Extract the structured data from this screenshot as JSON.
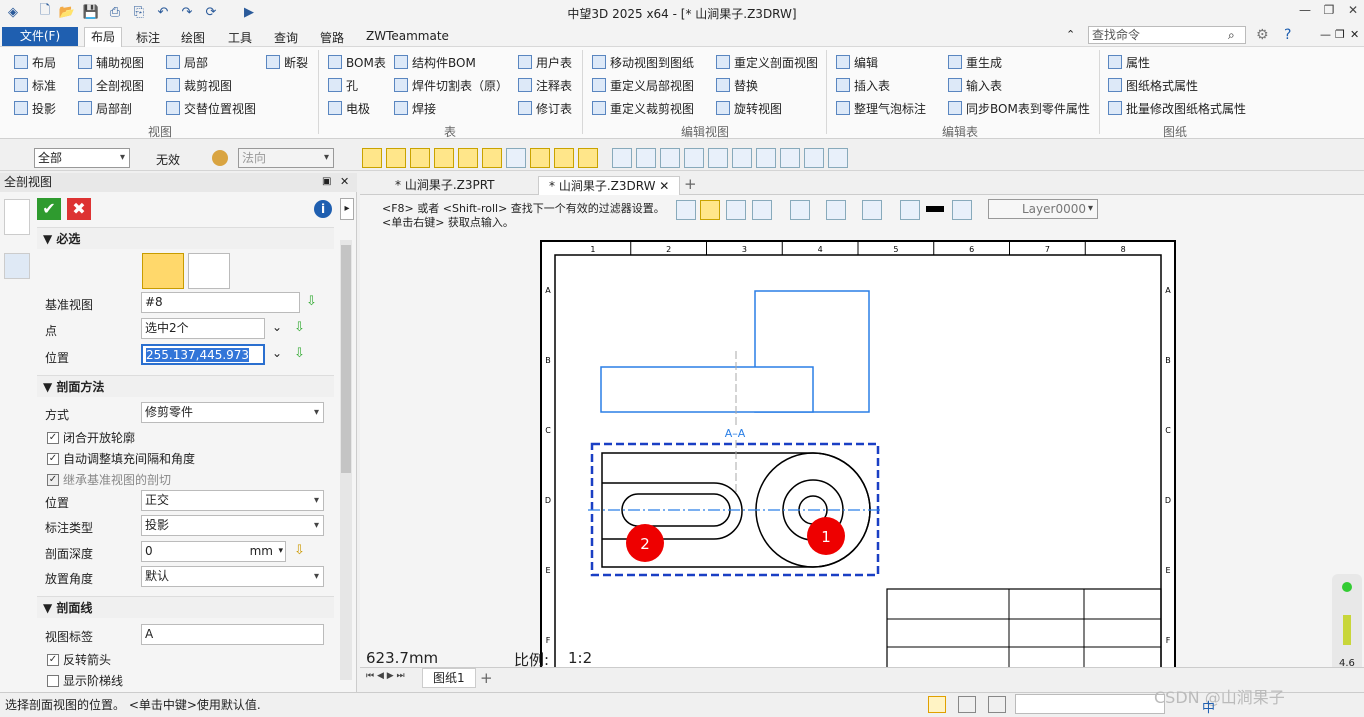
{
  "app": {
    "title": "中望3D 2025 x64 - [* 山涧果子.Z3DRW]"
  },
  "menu": {
    "file": "文件(F)",
    "tabs": [
      "布局",
      "标注",
      "绘图",
      "工具",
      "查询",
      "管路",
      "ZWTeammate"
    ],
    "search_placeholder": "查找命令"
  },
  "ribbon": {
    "view_group": {
      "label": "视图",
      "items": [
        "布局",
        "辅助视图",
        "局部",
        "断裂",
        "标准",
        "全剖视图",
        "裁剪视图",
        "投影",
        "局部剖",
        "交替位置视图"
      ]
    },
    "table_group": {
      "label": "表",
      "items": [
        "BOM表",
        "结构件BOM",
        "用户表",
        "孔",
        "焊件切割表（原）",
        "注释表",
        "电极",
        "焊接",
        "修订表"
      ]
    },
    "edit_view_group": {
      "label": "编辑视图",
      "items": [
        "移动视图到图纸",
        "重定义剖面视图",
        "重定义局部视图",
        "替换",
        "重定义裁剪视图",
        "旋转视图"
      ]
    },
    "edit_table_group": {
      "label": "编辑表",
      "items": [
        "编辑",
        "重生成",
        "插入表",
        "输入表",
        "整理气泡标注",
        "同步BOM表到零件属性"
      ]
    },
    "sheet_group": {
      "label": "图纸",
      "items": [
        "属性",
        "图纸格式属性",
        "批量修改图纸格式属性"
      ]
    }
  },
  "toolbar2": {
    "filter": "全部",
    "invalid": "无效",
    "normal": "法向"
  },
  "panel": {
    "title": "全剖视图",
    "section_required": "必选",
    "base_view_label": "基准视图",
    "base_view_value": "#8",
    "point_label": "点",
    "point_value": "选中2个",
    "position_label": "位置",
    "position_value": "255.137,445.973",
    "section_method": "剖面方法",
    "mode_label": "方式",
    "mode_value": "修剪零件",
    "chk1": "闭合开放轮廓",
    "chk2": "自动调整填充间隔和角度",
    "chk3": "继承基准视图的剖切",
    "pos_label": "位置",
    "pos_value": "正交",
    "dim_type_label": "标注类型",
    "dim_type_value": "投影",
    "depth_label": "剖面深度",
    "depth_value": "0",
    "depth_unit": "mm",
    "angle_label": "放置角度",
    "angle_value": "默认",
    "section_line": "剖面线",
    "view_label_label": "视图标签",
    "view_label_value": "A",
    "chk4": "反转箭头",
    "chk5": "显示阶梯线"
  },
  "docs": {
    "tab1": "* 山涧果子.Z3PRT",
    "tab2": "* 山涧果子.Z3DRW"
  },
  "hint": {
    "line1": "<F8> 或者 <Shift-roll> 查找下一个有效的过滤器设置。",
    "line2": "<单击右键> 获取点输入。"
  },
  "canvas": {
    "layer": "Layer0000",
    "length": "623.7mm",
    "scale_label": "比例:",
    "scale_value": "1:2",
    "section_mark": "A–A",
    "cols": [
      "1",
      "2",
      "3",
      "4",
      "5",
      "6",
      "7",
      "8"
    ],
    "rows": [
      "A",
      "B",
      "C",
      "D",
      "E",
      "F"
    ],
    "marker1": "1",
    "marker2": "2"
  },
  "sheet": {
    "tab": "图纸1"
  },
  "status": {
    "text": "选择剖面视图的位置。 <单击中键>使用默认值.",
    "watermark": "CSDN @山涧果子",
    "ime": "中",
    "perf": "4.6"
  }
}
